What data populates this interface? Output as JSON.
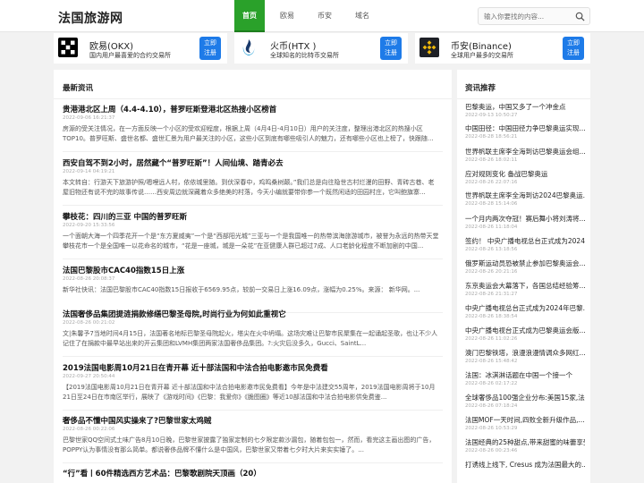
{
  "site": {
    "logo": "法国旅游网"
  },
  "nav": [
    {
      "label": "首页"
    },
    {
      "label": "欧易"
    },
    {
      "label": "币安"
    },
    {
      "label": "域名"
    }
  ],
  "search": {
    "placeholder": "输入你要找的内容..."
  },
  "exchanges": [
    {
      "name": "欧易(OKX)",
      "desc": "国内用户最喜爱的合约交易所",
      "btn_line1": "立即",
      "btn_line2": "注册"
    },
    {
      "name": "火币(HTX )",
      "desc": "全球知名的比特币交易所",
      "btn_line1": "立即",
      "btn_line2": "注册"
    },
    {
      "name": "币安(Binance)",
      "desc": "全球用户最多的交易所",
      "btn_line1": "立即",
      "btn_line2": "注册"
    }
  ],
  "main": {
    "title": "最新资讯",
    "articles": [
      {
        "title": "贵港港北区上周（4.4-4.10），普罗旺斯登港北区热搜小区榜首",
        "date": "2022-09-06 16:21:37",
        "excerpt": "房源的受关注情况，在一方面反映一个小区的受欢迎程度，根据上周（4月4日-4月10日）用户的关注度，整理出港北区的热搜小区TOP10。普罗旺斯、盛世名都、盛世汇景为用户最关注的小区，这些小区到底有哪些吸引人的魅力，还有哪些小区也上榜了，快跟随..."
      },
      {
        "title": "西安自驾不到2小时，居然藏个“普罗旺斯”！人间仙境、踏青必去",
        "date": "2022-09-14 04:19:21",
        "excerpt": "本文转自：行游天下旅游护照/嗯哩远人村，依依城里随。到伏深春中，鸡鸣桑树颠。”我们总是向往隐世古村烂漫的田野、青砖古巷、老屋旧物还有说不完的故事传说……西安周边就深藏着众多绝美的村落，今天小编就要带你参一个既然闲适的田园村庄，它叫鲍旗寨..."
      },
      {
        "title": "攀枝花：四川的三亚 中国的普罗旺斯",
        "date": "2022-09-20 15:33:56",
        "excerpt": "一个面朝大海一个四季花开一个是“东方夏威夷”一个是“西部阳光城”三亚与一个是我国唯一的热带滨海旅游城市，被誉为永远的热带天堂攀枝花市一个是全国唯一以花命名的城市，“花是一座城，城是一朵花”在亚健康人群已超过7成、人口老龄化程度不断加剧的中国..."
      },
      {
        "title": "法国巴黎股市CAC40指数15日上涨",
        "date": "2022-08-26 20:08:37",
        "excerpt": "新华社快讯：法国巴黎股市CAC40指数15日报收于6569.95点，较前一交易日上涨16.09点，涨幅为0.25%。来源： 新华网。..."
      },
      {
        "title": "法国奢侈品集团提涟捐款修缮巴黎圣母院,时尚行业为何如此重视它",
        "date": "2022-08-26 00:21:02",
        "excerpt": "文|朱馨予7当地时间4月15日，法国著名地标巴黎圣母院起火，塔尖在火中坍塌。这场灾难让巴黎市民聚集在一起诵起圣歌，也让不少人记住了在捐款中最早站出来的开云集团和LVMH集团两家法国奢侈品集团。?:火灾后没多久，Gucci、SaintL..."
      },
      {
        "title": "2019法国电影周10月21日在青开幕 近十部法国和中法合拍电影邀市民免费看",
        "date": "2022-09-27 20:50:44",
        "excerpt": "【2019法国电影周10月21日在青开幕 近十部法国和中法合拍电影邀市民免费看】今年是中法建交55周年，2019法国电影周将于10月21日至24日在市南区举行，展映了《游戏时间》《巴黎：我爱你》《脆图圈》等近10部法国和中法合拍电影供免费鉴..."
      },
      {
        "title": "奢侈品不懂中国风实操来了?巴黎世家太鸡贼",
        "date": "2022-08-26 00:22:06",
        "excerpt": "巴黎世家QQ空间式土味广告8月10日晚，巴黎世家披露了独家定制的七夕限定款沙漏包，随着包包一，然而，看完这主画出图的广告，POPPY认为事情没有那么简单。都说奢侈品牌不懂什么是中国风，巴黎世家又带着七夕时大片来实实锤了。..."
      },
      {
        "title": "“行”看丨60件精选西方艺术品：巴黎歌剧院天顶画（20）",
        "date": "",
        "excerpt": ""
      }
    ]
  },
  "sidebar": {
    "title": "资讯推荐",
    "items": [
      {
        "title": "巴黎奥运，中国又多了一个冲金点",
        "date": "2022-09-13 10:50:27"
      },
      {
        "title": "中国田径：中国田径力争巴黎奥运实现...",
        "date": "2022-08-28 18:56:21"
      },
      {
        "title": "世界帆联主席李全海到访巴黎奥运会组...",
        "date": "2022-08-26 18:02:11"
      },
      {
        "title": "应对规则变化 备战巴黎奥运",
        "date": "2022-08-26 22:07:16"
      },
      {
        "title": "世界帆联主席李全海到访2024巴黎奥运...",
        "date": "2022-08-28 15:14:06"
      },
      {
        "title": "一个月内两次夺冠！赛后舞小将刘涛将...",
        "date": "2022-08-26 11:18:04"
      },
      {
        "title": "签约！ 中央广播电视总台正式成为2024...",
        "date": "2022-08-26 13:18:56"
      },
      {
        "title": "俄罗斯运动员恐被禁止参加巴黎奥运会...",
        "date": "2022-08-26 20:21:16"
      },
      {
        "title": "东京奥运会大幕落下，各国总结经验筹...",
        "date": "2022-08-26 21:31:27"
      },
      {
        "title": "中央广播电视总台正式成为2024年巴黎...",
        "date": "2022-08-26 18:38:54"
      },
      {
        "title": "中央广播电视台正式成为巴黎奥运会版...",
        "date": "2022-08-26 11:02:26"
      },
      {
        "title": "澳门巴黎铁塔，浪漫浪漫情调众多网红...",
        "date": "2022-08-26 15:48:42"
      },
      {
        "title": "法国：冰淇淋话题在中国一个接一个",
        "date": "2022-08-26 02:17:22"
      },
      {
        "title": "全球奢侈品100强企业分布:美国15家,法...",
        "date": "2022-08-26 07:18:24"
      },
      {
        "title": "法国MOF一天时间,四败全新升级作品,...",
        "date": "2022-08-26 10:53:29"
      },
      {
        "title": "法国经典的25种甜点,带来甜蜜的味蕾享受",
        "date": "2022-08-26 00:23:46"
      },
      {
        "title": "打诱线上线下, Cresus 成为法国最大的...",
        "date": ""
      }
    ]
  },
  "colors": {
    "nav_active": "#2aa12a",
    "button": "#1e7be8",
    "background": "#f2f2f2"
  }
}
